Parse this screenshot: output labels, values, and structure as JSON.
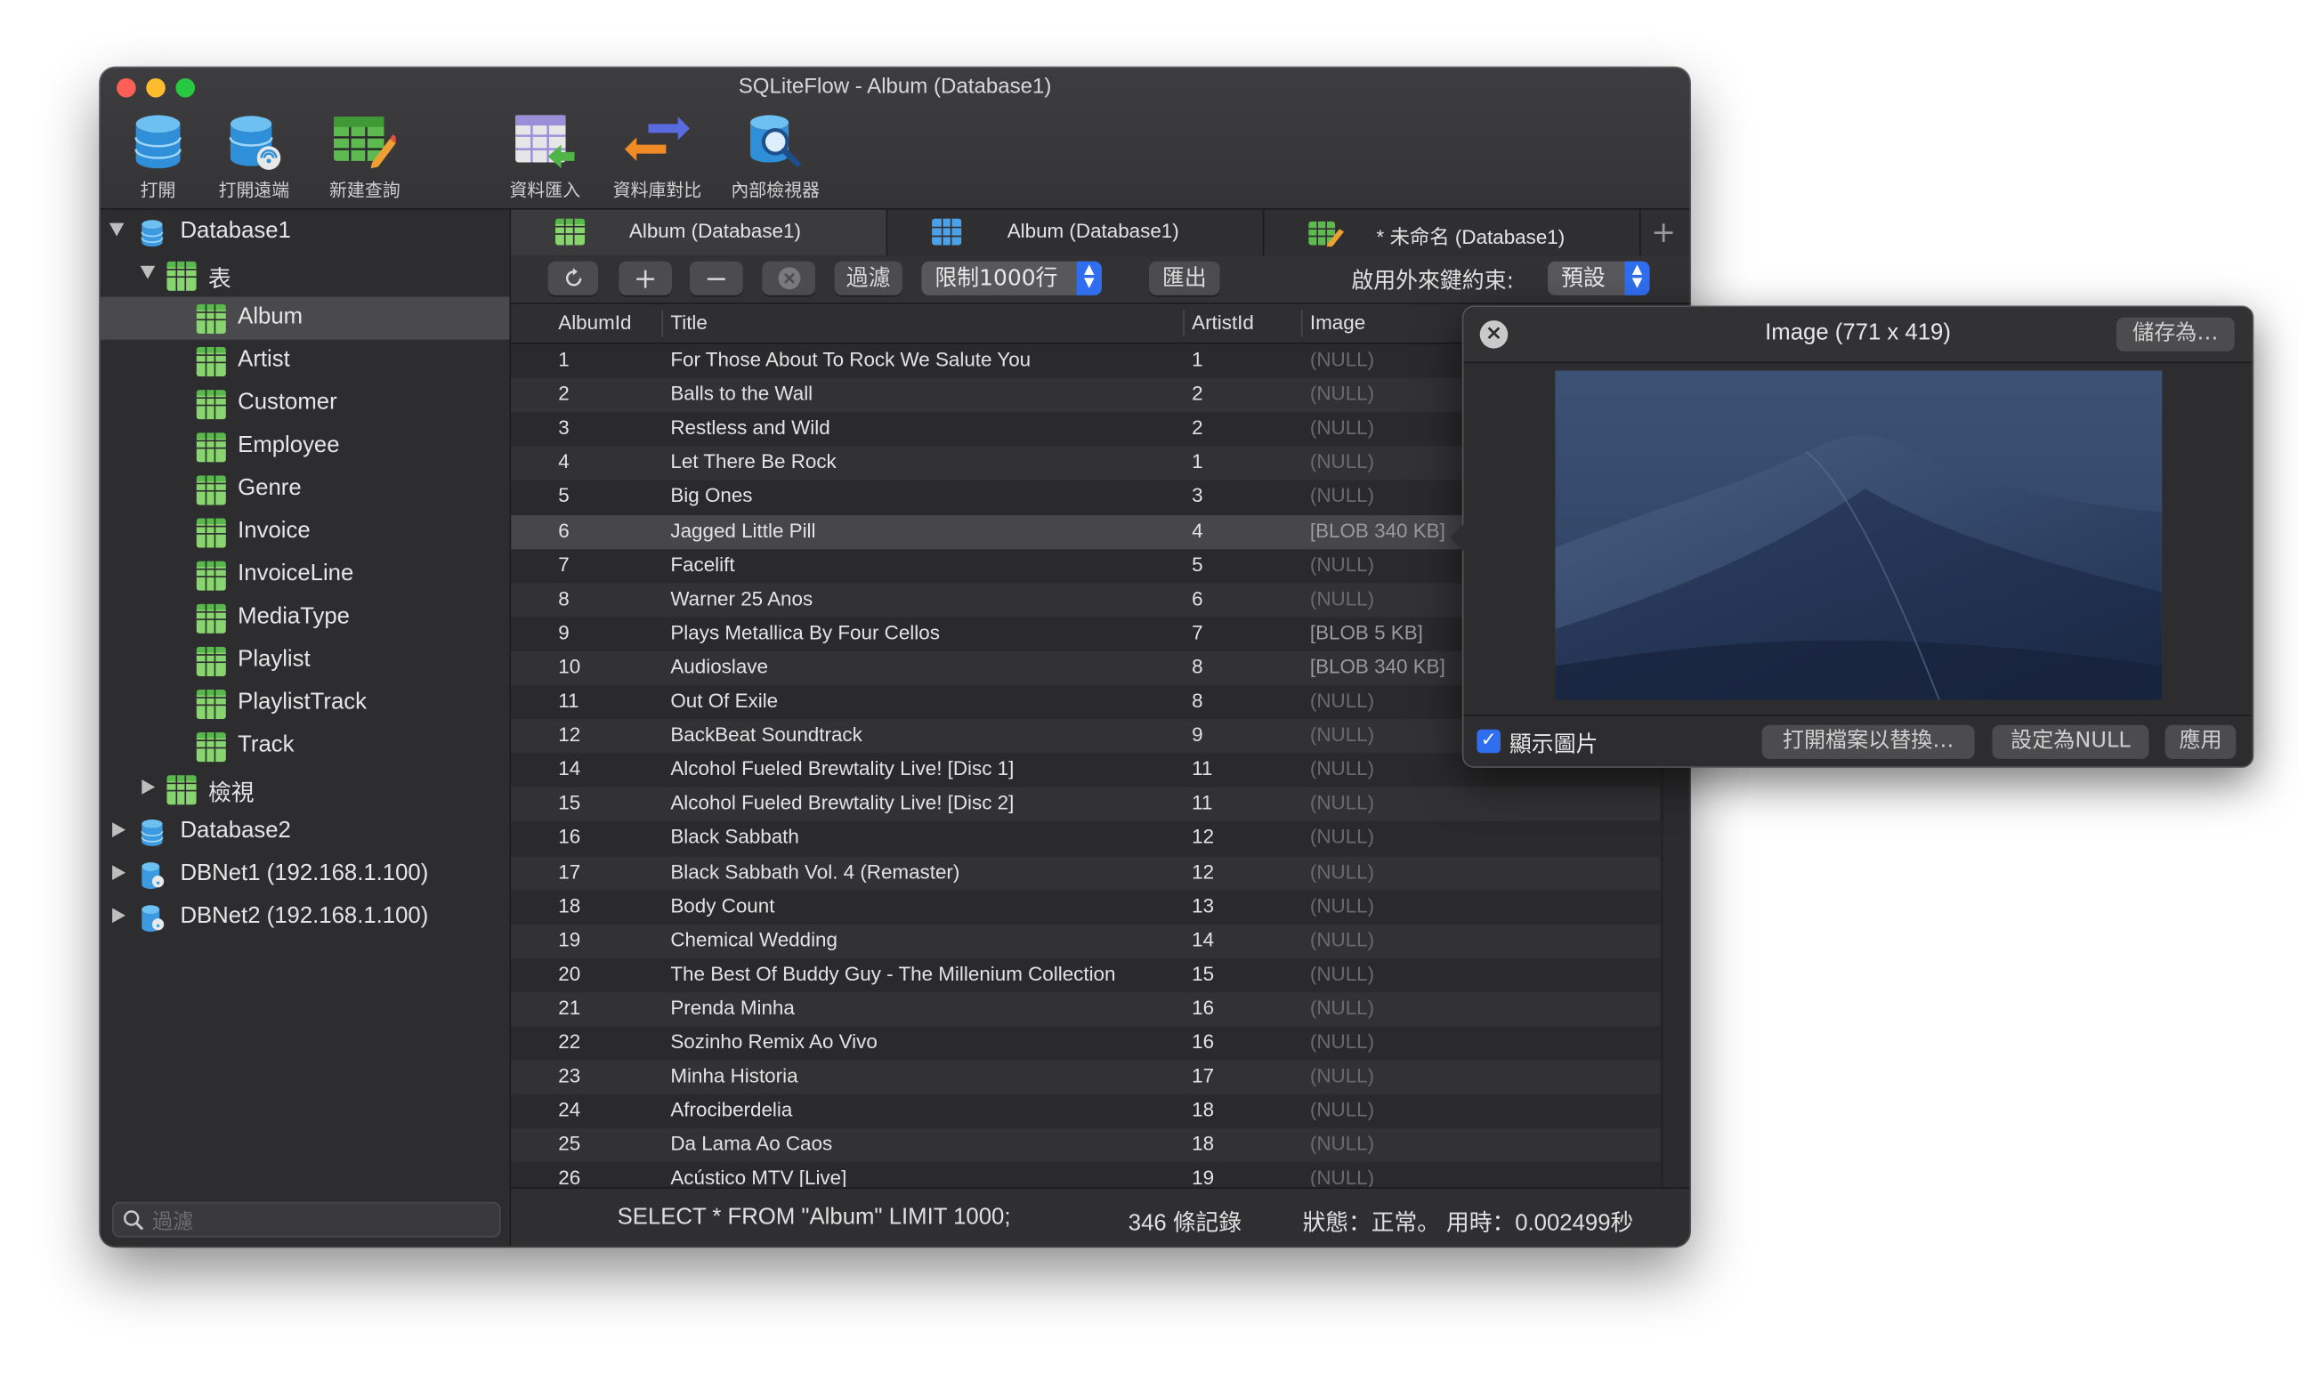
{
  "window": {
    "title": "SQLiteFlow  -  Album (Database1)"
  },
  "toolbar": {
    "open": "打開",
    "open_remote": "打開遠端",
    "new_query": "新建查詢",
    "import": "資料匯入",
    "compare": "資料庫對比",
    "inspector": "內部檢視器"
  },
  "sidebar": {
    "filter_placeholder": "過濾",
    "database1": "Database1",
    "tables_group": "表",
    "tables": [
      "Album",
      "Artist",
      "Customer",
      "Employee",
      "Genre",
      "Invoice",
      "InvoiceLine",
      "MediaType",
      "Playlist",
      "PlaylistTrack",
      "Track"
    ],
    "views_group": "檢視",
    "database2": "Database2",
    "dbnet1": "DBNet1 (192.168.1.100)",
    "dbnet2": "DBNet2 (192.168.1.100)"
  },
  "tabs": [
    "Album (Database1)",
    "Album (Database1)",
    "* 未命名 (Database1)"
  ],
  "tab_add": "+",
  "table_toolbar": {
    "filter": "過濾",
    "limit": "限制1000行",
    "export": "匯出",
    "fk_label": "啟用外來鍵約束:",
    "fk_value": "預設"
  },
  "columns": [
    "AlbumId",
    "Title",
    "ArtistId",
    "Image"
  ],
  "rows": [
    [
      "1",
      "For Those About To Rock We Salute You",
      "1",
      "(NULL)"
    ],
    [
      "2",
      "Balls to the Wall",
      "2",
      "(NULL)"
    ],
    [
      "3",
      "Restless and Wild",
      "2",
      "(NULL)"
    ],
    [
      "4",
      "Let There Be Rock",
      "1",
      "(NULL)"
    ],
    [
      "5",
      "Big Ones",
      "3",
      "(NULL)"
    ],
    [
      "6",
      "Jagged Little Pill",
      "4",
      "[BLOB 340 KB]"
    ],
    [
      "7",
      "Facelift",
      "5",
      "(NULL)"
    ],
    [
      "8",
      "Warner 25 Anos",
      "6",
      "(NULL)"
    ],
    [
      "9",
      "Plays Metallica By Four Cellos",
      "7",
      "[BLOB 5 KB]"
    ],
    [
      "10",
      "Audioslave",
      "8",
      "[BLOB 340 KB]"
    ],
    [
      "11",
      "Out Of Exile",
      "8",
      "(NULL)"
    ],
    [
      "12",
      "BackBeat Soundtrack",
      "9",
      "(NULL)"
    ],
    [
      "14",
      "Alcohol Fueled Brewtality Live! [Disc 1]",
      "11",
      "(NULL)"
    ],
    [
      "15",
      "Alcohol Fueled Brewtality Live! [Disc 2]",
      "11",
      "(NULL)"
    ],
    [
      "16",
      "Black Sabbath",
      "12",
      "(NULL)"
    ],
    [
      "17",
      "Black Sabbath Vol. 4 (Remaster)",
      "12",
      "(NULL)"
    ],
    [
      "18",
      "Body Count",
      "13",
      "(NULL)"
    ],
    [
      "19",
      "Chemical Wedding",
      "14",
      "(NULL)"
    ],
    [
      "20",
      "The Best Of Buddy Guy - The Millenium Collection",
      "15",
      "(NULL)"
    ],
    [
      "21",
      "Prenda Minha",
      "16",
      "(NULL)"
    ],
    [
      "22",
      "Sozinho Remix Ao Vivo",
      "16",
      "(NULL)"
    ],
    [
      "23",
      "Minha Historia",
      "17",
      "(NULL)"
    ],
    [
      "24",
      "Afrociberdelia",
      "18",
      "(NULL)"
    ],
    [
      "25",
      "Da Lama Ao Caos",
      "18",
      "(NULL)"
    ],
    [
      "26",
      "Acústico MTV [Live]",
      "19",
      "(NULL)"
    ]
  ],
  "selected_row": 5,
  "status": {
    "query": "SELECT * FROM \"Album\" LIMIT 1000;",
    "count": "346 條記錄",
    "state": "狀態：正常。 用時：0.002499秒"
  },
  "image_popover": {
    "title": "Image (771 x 419)",
    "save_as": "儲存為…",
    "show_image": "顯示圖片",
    "show_image_checked": true,
    "open_file": "打開檔案以替換…",
    "set_null": "設定為NULL",
    "apply": "應用"
  },
  "colors": {
    "accent": "#2f6ef0",
    "table_icon": "#58b84c",
    "db_icon": "#3c9be0"
  }
}
